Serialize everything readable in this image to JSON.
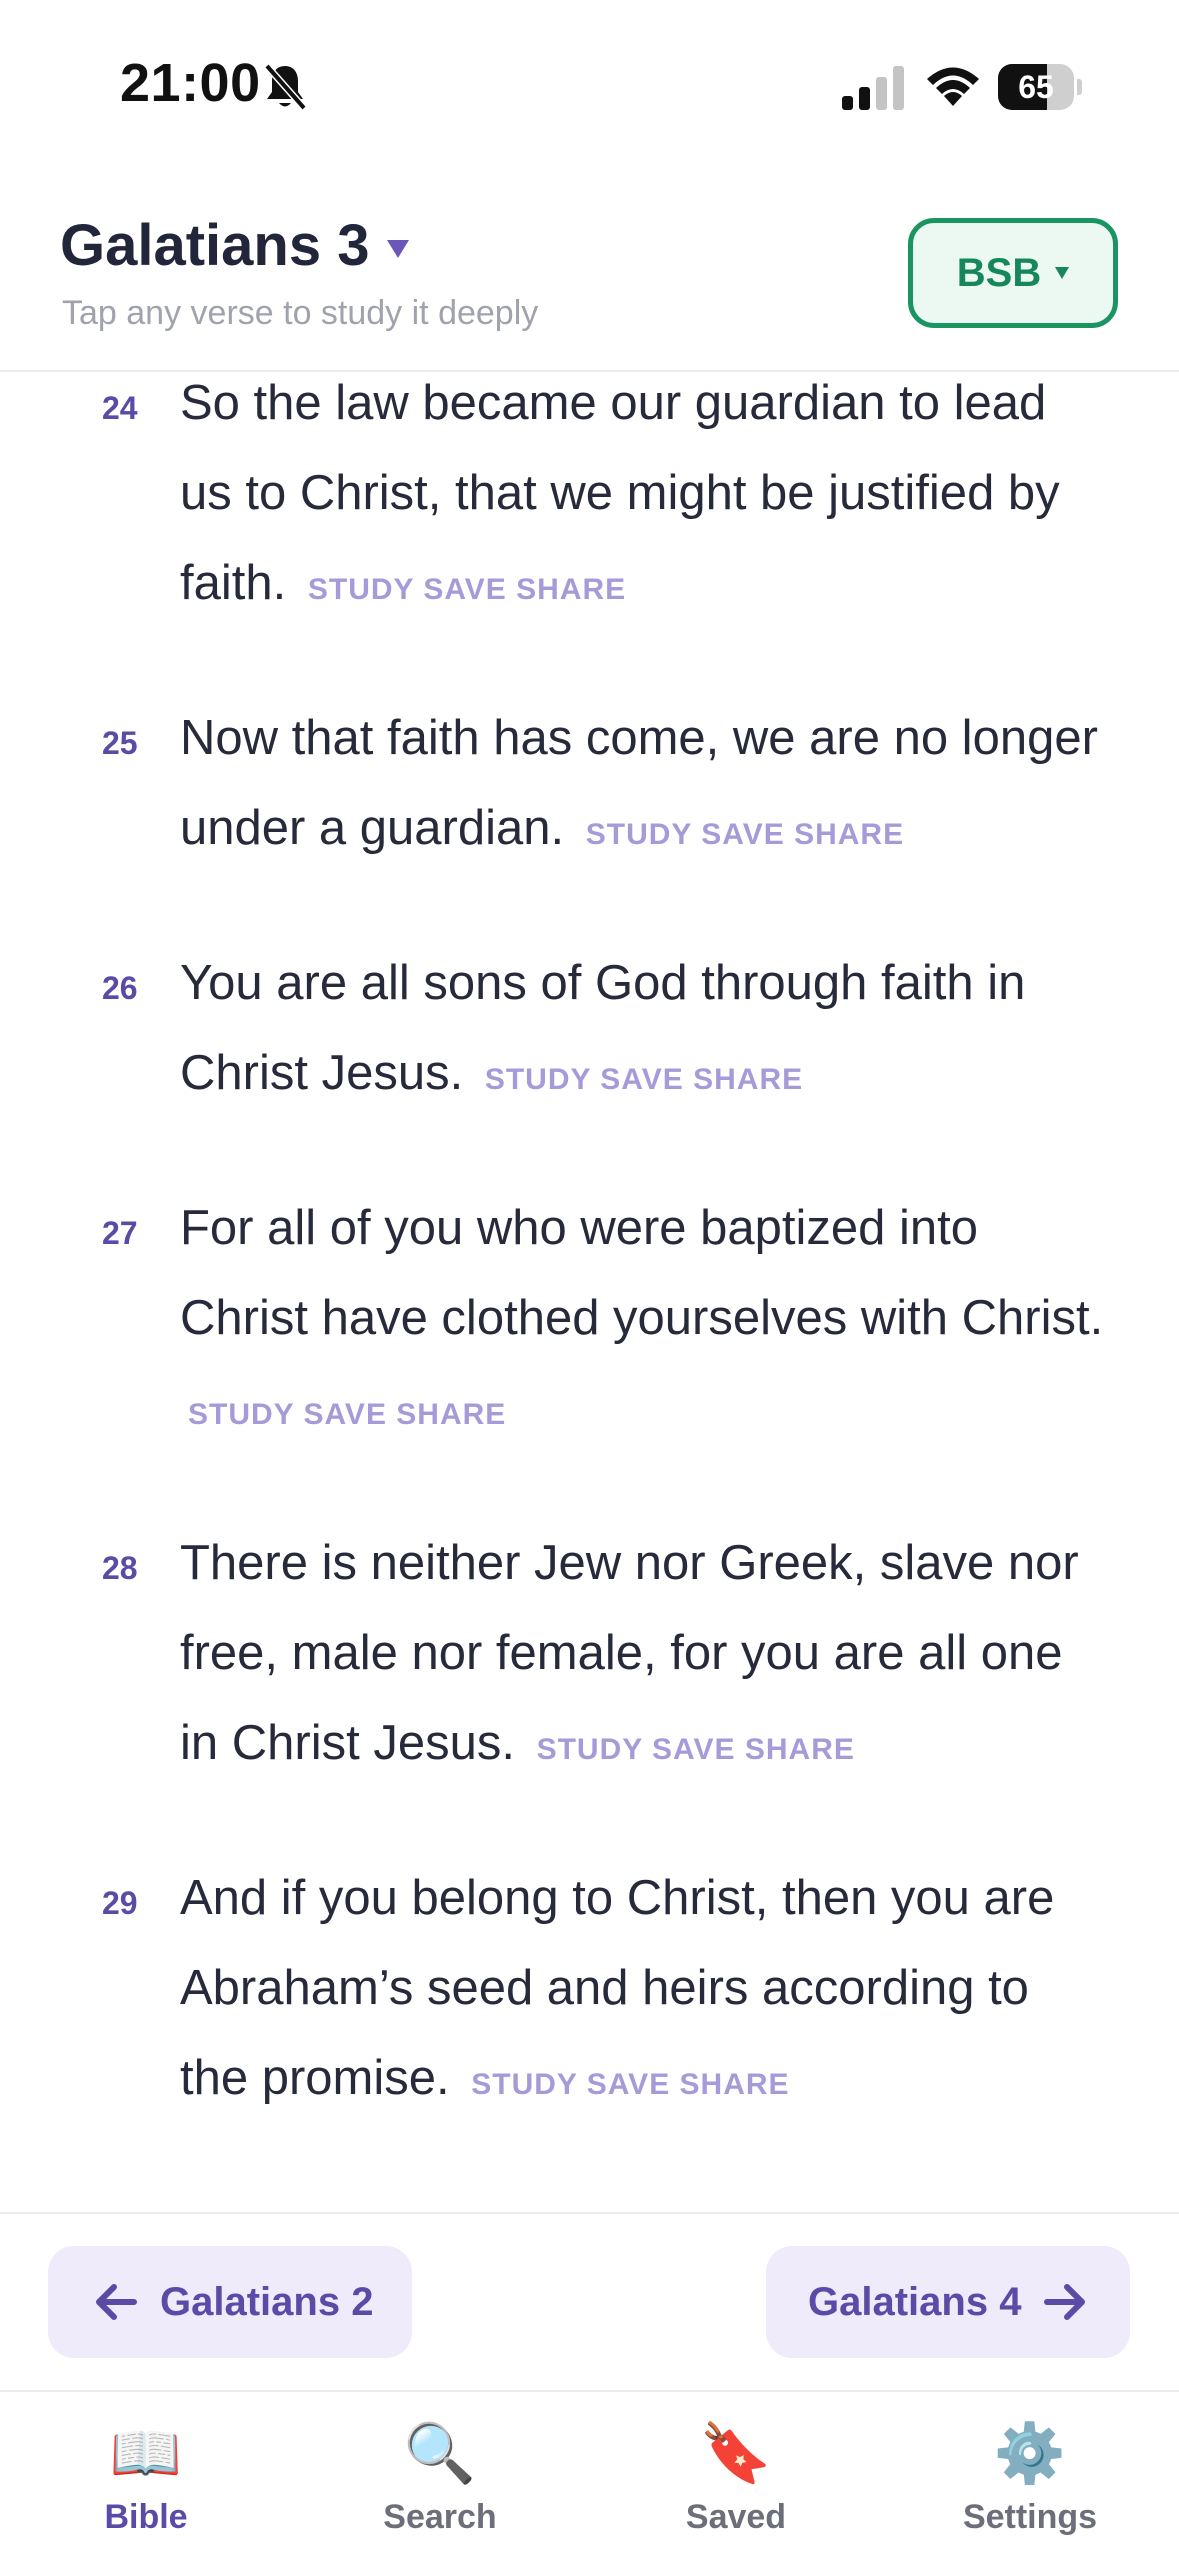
{
  "status_bar": {
    "time": "21:00",
    "battery": "65",
    "battery_level": 0.65
  },
  "header": {
    "chapter_title": "Galatians 3",
    "subtitle": "Tap any verse to study it deeply",
    "version_label": "BSB"
  },
  "verse_actions": {
    "study": "STUDY",
    "save": "SAVE",
    "share": "SHARE"
  },
  "verses": [
    {
      "number": "24",
      "text": "So the law became our guardian to lead us to Christ, that we might be justified by faith."
    },
    {
      "number": "25",
      "text": "Now that faith has come, we are no longer under a guardian."
    },
    {
      "number": "26",
      "text": "You are all sons of God through faith in Christ Jesus."
    },
    {
      "number": "27",
      "text": "For all of you who were baptized into Christ have clothed yourselves with Christ."
    },
    {
      "number": "28",
      "text": "There is neither Jew nor Greek, slave nor free, male nor female, for you are all one in Christ Jesus."
    },
    {
      "number": "29",
      "text": "And if you belong to Christ, then you are Abraham’s seed and heirs according to the promise."
    }
  ],
  "chapter_nav": {
    "prev_label": "Galatians 2",
    "next_label": "Galatians 4"
  },
  "tabs": [
    {
      "label": "Bible",
      "icon": "open-book-icon",
      "glyph": "📖",
      "active": true
    },
    {
      "label": "Search",
      "icon": "magnifier-icon",
      "glyph": "🔍",
      "active": false
    },
    {
      "label": "Saved",
      "icon": "bookmark-tag-icon",
      "glyph": "🔖",
      "active": false
    },
    {
      "label": "Settings",
      "icon": "gear-icon",
      "glyph": "⚙️",
      "active": false
    }
  ],
  "colors": {
    "accent": "#5b4aa6",
    "version_green": "#15875a",
    "action_text": "#a79ad8"
  }
}
